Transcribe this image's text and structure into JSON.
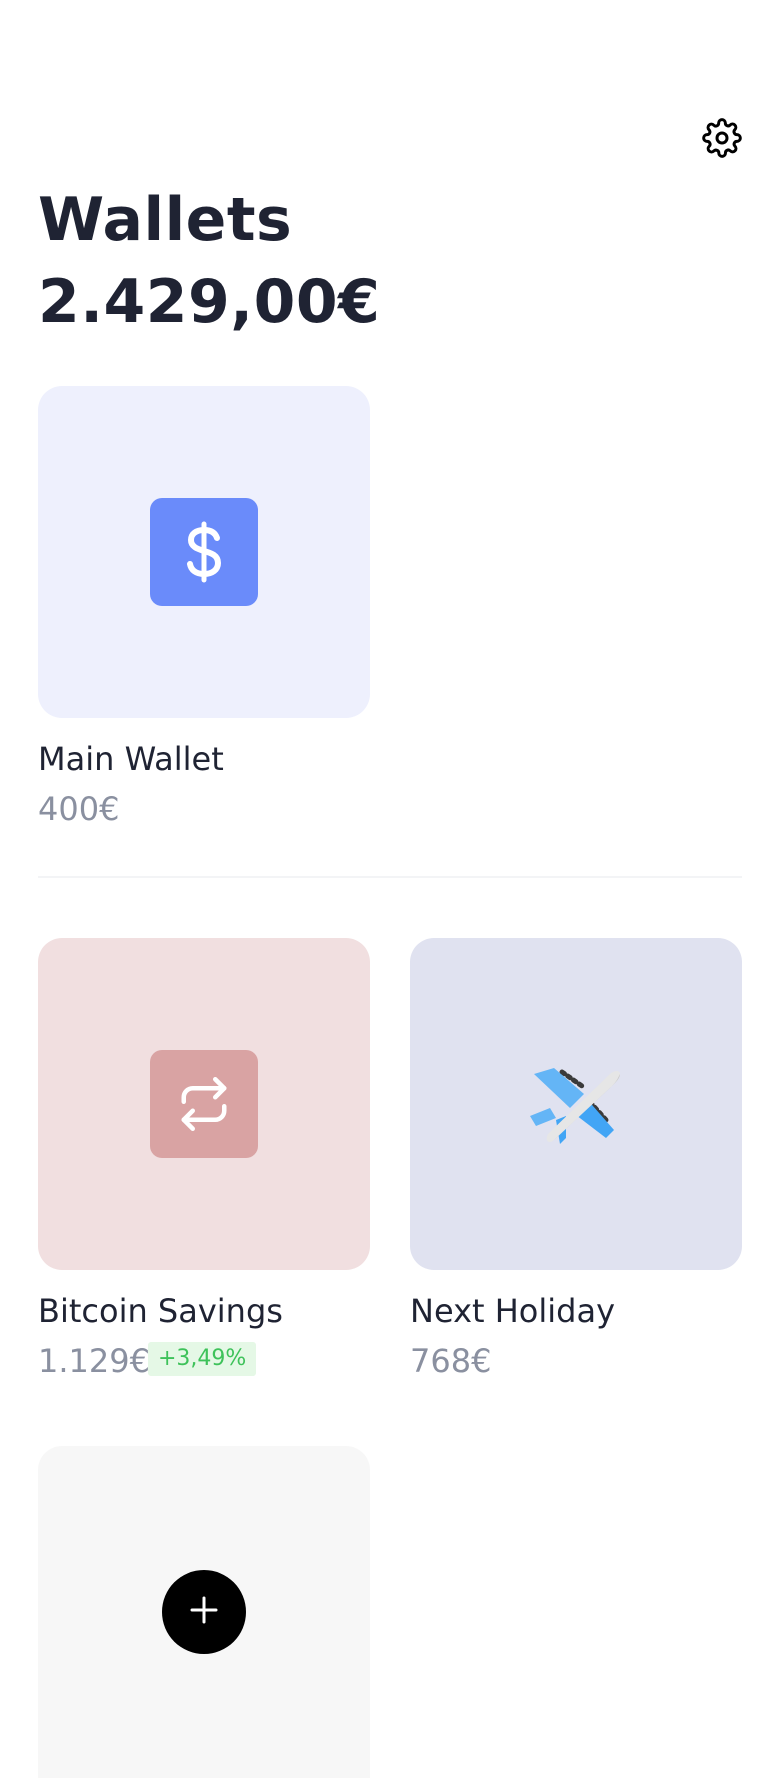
{
  "header": {
    "title": "Wallets",
    "total_balance": "2.429,00€",
    "settings_icon": "gear-icon"
  },
  "wallets": [
    {
      "name": "Main Wallet",
      "amount": "400€",
      "icon": "dollar-icon",
      "card_color": "#eef0fd",
      "icon_color": "#6a8bfa"
    },
    {
      "name": "Bitcoin Savings",
      "amount": "1.129€",
      "change": "+3,49%",
      "icon": "repeat-icon",
      "card_color": "#f1dfe0",
      "icon_color": "#d9a3a3"
    },
    {
      "name": "Next Holiday",
      "amount": "768€",
      "icon": "airplane-icon",
      "card_color": "#e0e2f0"
    }
  ],
  "add_wallet": {
    "icon": "plus-icon",
    "card_color": "#f7f7f7",
    "button_color": "#000000"
  },
  "colors": {
    "text_primary": "#1f2333",
    "text_secondary": "#8a90a0",
    "positive_change": "#3ec25a",
    "positive_change_bg": "#e5f8e6"
  }
}
